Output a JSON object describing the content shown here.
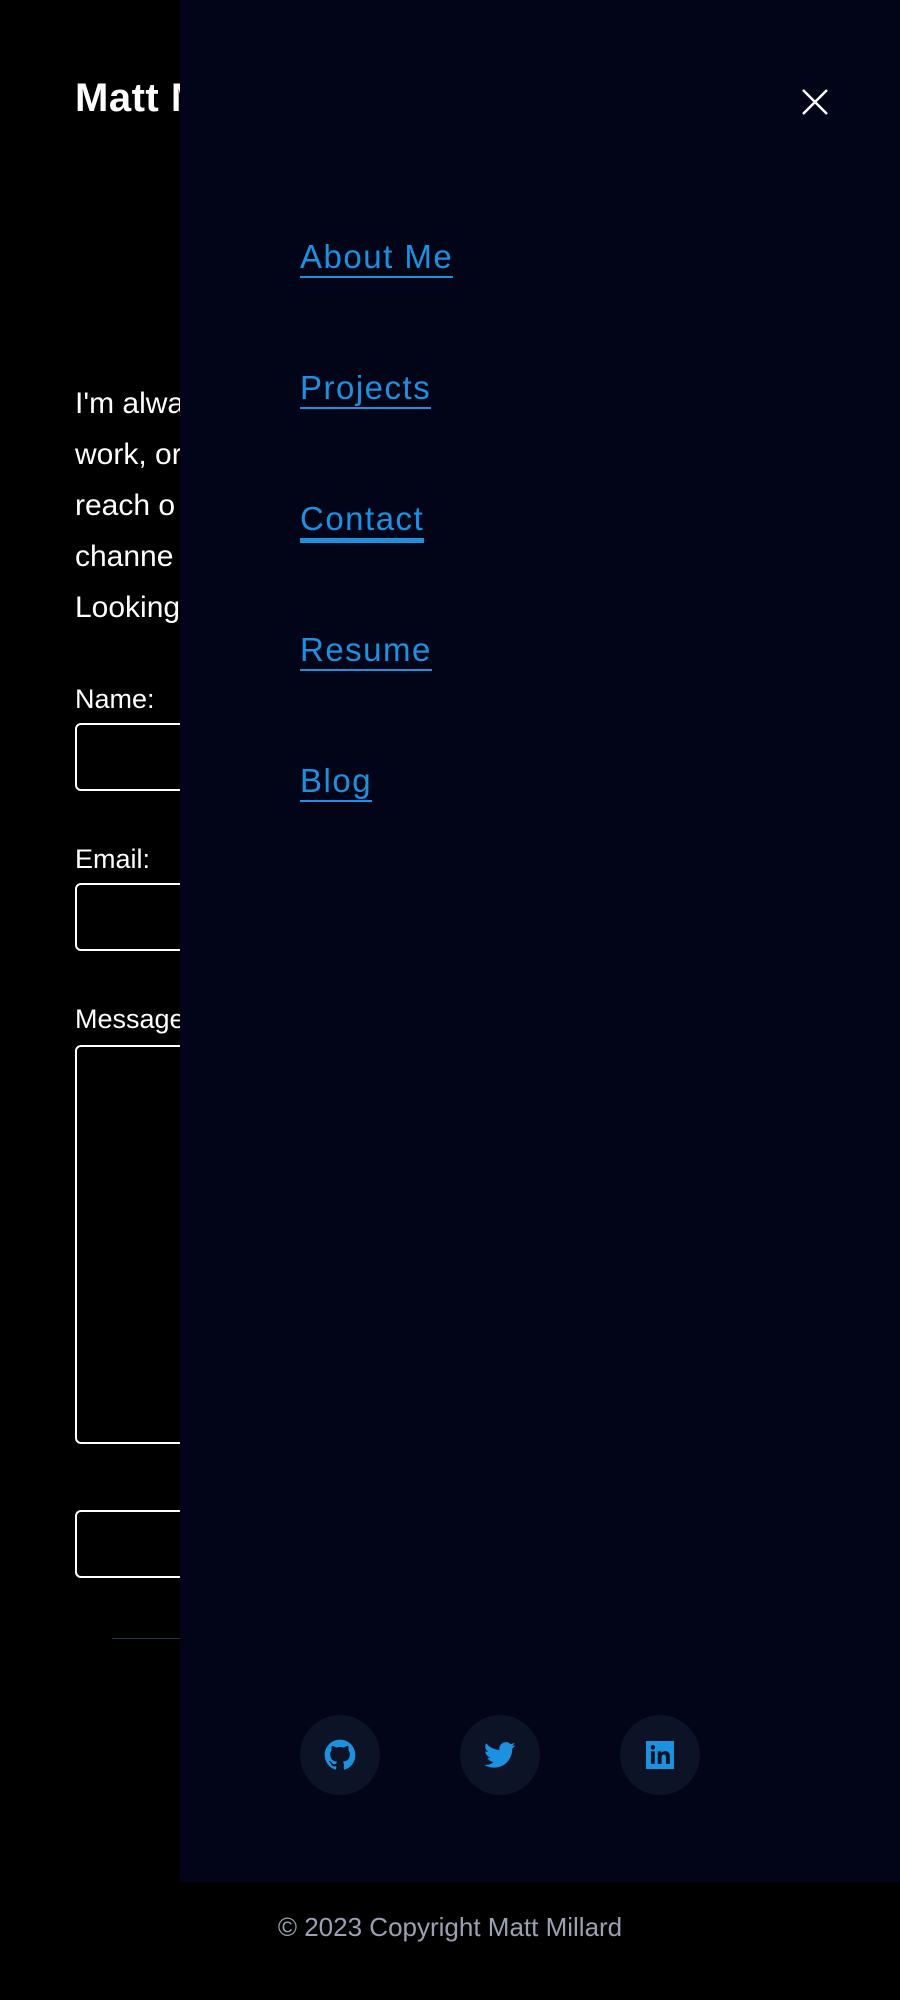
{
  "site": {
    "title": "Matt Millard"
  },
  "contact": {
    "intro_lines": [
      "I'm always",
      "work, or",
      "reach o",
      "channe",
      "Looking"
    ],
    "name_label": "Name:",
    "email_label": "Email:",
    "message_label": "Message:",
    "name_value": "",
    "email_value": "",
    "message_value": "",
    "submit_label": ""
  },
  "drawer": {
    "close_icon": "close-icon",
    "nav": [
      {
        "label": "About Me",
        "active": false
      },
      {
        "label": "Projects",
        "active": false
      },
      {
        "label": "Contact",
        "active": true
      },
      {
        "label": "Resume",
        "active": false
      },
      {
        "label": "Blog",
        "active": false
      }
    ],
    "social": [
      {
        "icon": "github-icon"
      },
      {
        "icon": "twitter-icon"
      },
      {
        "icon": "linkedin-icon"
      }
    ]
  },
  "footer": {
    "copyright": "© 2023 Copyright Matt Millard"
  },
  "colors": {
    "accent": "#1b91e0",
    "drawer_bg": "#020418",
    "page_bg": "#000000",
    "footer_text": "#9aa1b2"
  }
}
